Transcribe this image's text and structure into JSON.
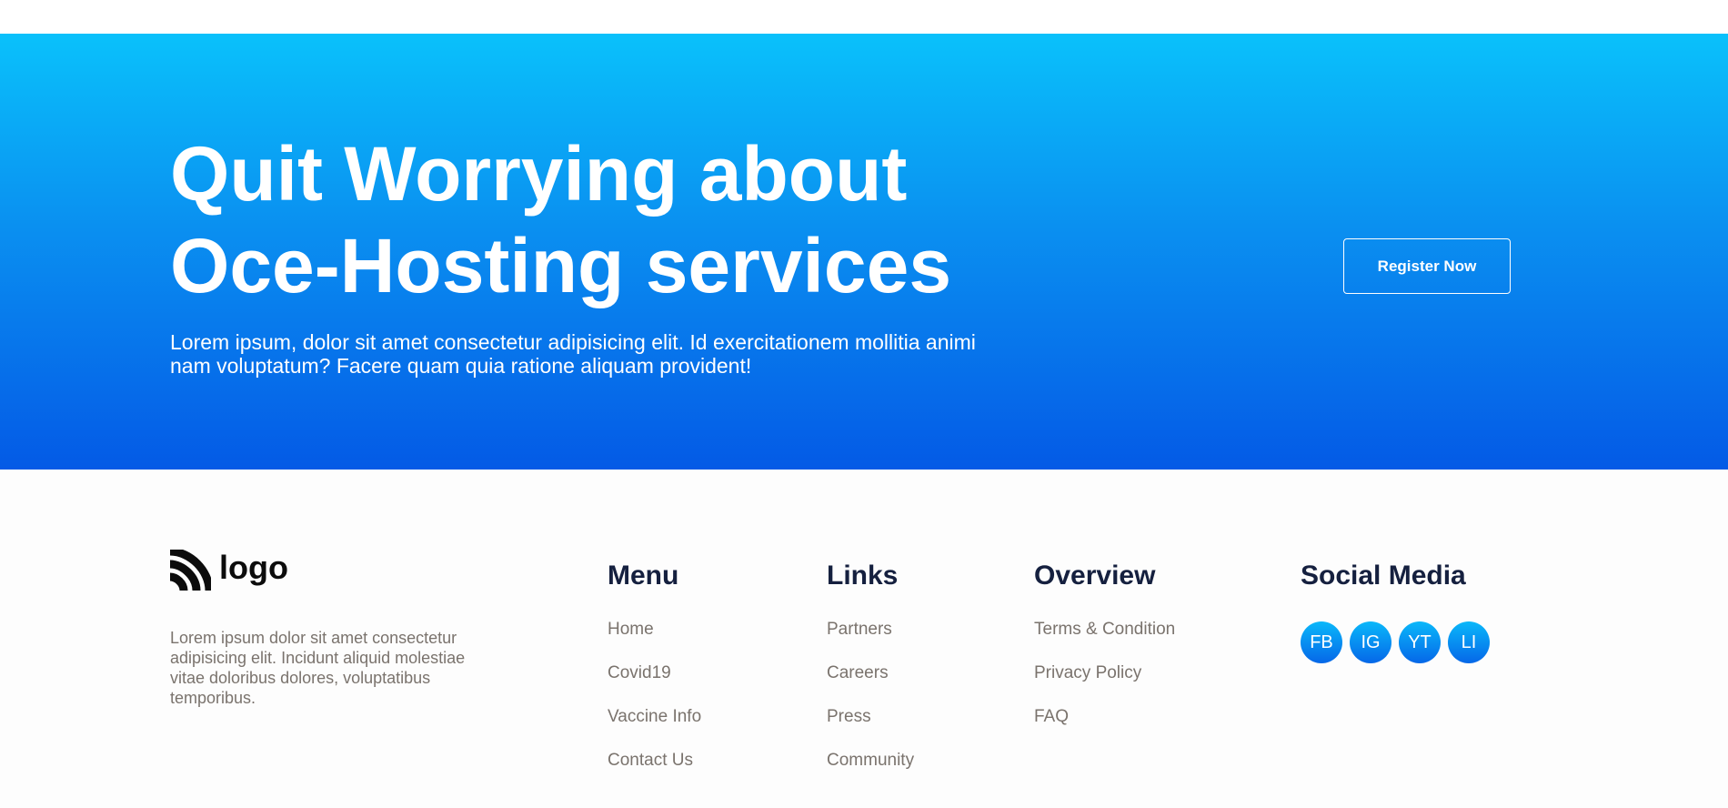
{
  "hero": {
    "title_line1": "Quit Worrying about",
    "title_line2": "Oce-Hosting services",
    "description": "Lorem ipsum, dolor sit amet consectetur adipisicing elit. Id exercitationem mollitia animi nam voluptatum? Facere quam quia ratione aliquam provident!",
    "register_label": "Register Now"
  },
  "footer": {
    "logo_text": "logo",
    "description": "Lorem ipsum dolor sit amet consectetur adipisicing elit. Incidunt aliquid molestiae vitae doloribus dolores, voluptatibus temporibus.",
    "menu": {
      "heading": "Menu",
      "items": [
        "Home",
        "Covid19",
        "Vaccine Info",
        "Contact Us"
      ]
    },
    "links": {
      "heading": "Links",
      "items": [
        "Partners",
        "Careers",
        "Press",
        "Community"
      ]
    },
    "overview": {
      "heading": "Overview",
      "items": [
        "Terms & Condition",
        "Privacy Policy",
        "FAQ"
      ]
    },
    "social": {
      "heading": "Social Media",
      "items": [
        "FB",
        "IG",
        "YT",
        "LI"
      ]
    }
  },
  "colors": {
    "hero_gradient_top": "#0ac1fb",
    "hero_gradient_bottom": "#045ae6",
    "heading": "#15203f",
    "link": "#7a736d"
  }
}
